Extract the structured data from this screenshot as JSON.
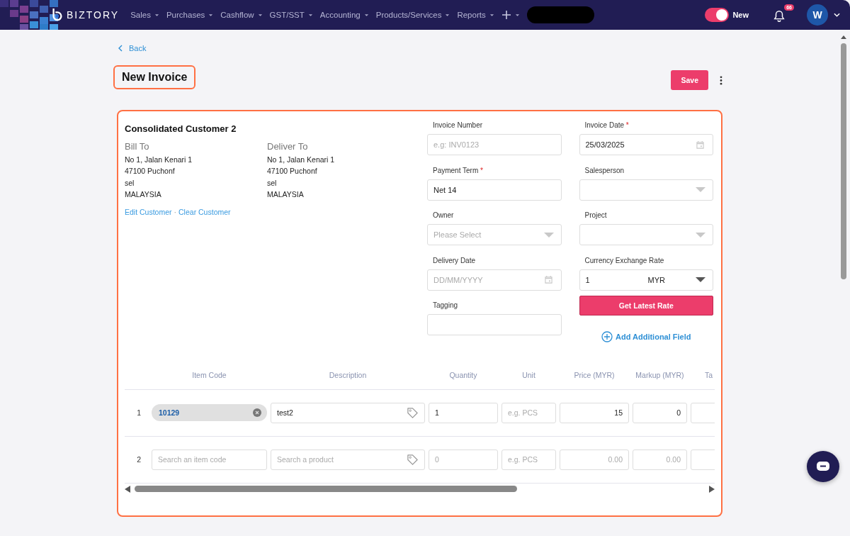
{
  "nav": {
    "brand": "BIZTORY",
    "menu": [
      {
        "label": "Sales"
      },
      {
        "label": "Purchases"
      },
      {
        "label": "Cashflow"
      },
      {
        "label": "GST/SST"
      },
      {
        "label": "Accounting"
      },
      {
        "label": "Products/Services"
      },
      {
        "label": "Reports"
      }
    ],
    "new_toggle": {
      "label": "New",
      "on": true
    },
    "notifications": {
      "badge": "66"
    },
    "avatar": {
      "initial": "W"
    }
  },
  "back": "Back",
  "title": "New Invoice",
  "save": "Save",
  "customer": {
    "name": "Consolidated Customer 2",
    "addresses": [
      {
        "heading": "Bill To",
        "lines": [
          "No 1, Jalan Kenari 1",
          "47100 Puchonf",
          "sel",
          "MALAYSIA"
        ]
      },
      {
        "heading": "Deliver To",
        "lines": [
          "No 1, Jalan Kenari 1",
          "47100 Puchonf",
          "sel",
          "MALAYSIA"
        ]
      }
    ],
    "edit_link": "Edit Customer",
    "separator": "·",
    "clear_link": "Clear Customer"
  },
  "fields_left": [
    {
      "kind": "text",
      "label": "Invoice Number",
      "placeholder": "e.g: INV0123"
    },
    {
      "kind": "text",
      "label": "Payment Term",
      "mark": "*",
      "value": "Net 14"
    },
    {
      "kind": "select",
      "label": "Owner",
      "placeholder": "Please Select"
    },
    {
      "kind": "date",
      "label": "Delivery Date",
      "placeholder": "DD/MM/YYYY"
    },
    {
      "kind": "text",
      "label": "Tagging"
    }
  ],
  "fields_right": [
    {
      "kind": "date",
      "label": "Invoice Date",
      "mark": "*",
      "value": "25/03/2025"
    },
    {
      "kind": "select",
      "label": "Salesperson"
    },
    {
      "kind": "select",
      "label": "Project"
    },
    {
      "kind": "currency",
      "label": "Currency Exchange Rate",
      "value": "1",
      "currency": "MYR"
    }
  ],
  "rate_button": "Get Latest Rate",
  "add_field": "Add Additional Field",
  "table": {
    "columns": [
      "Item Code",
      "Description",
      "Quantity",
      "Unit",
      "Price (MYR)",
      "Markup (MYR)",
      "Ta"
    ],
    "rows": [
      {
        "number": "1",
        "item_code": {
          "value": "10129"
        },
        "description": {
          "value": "test2"
        },
        "quantity": {
          "value": "1"
        },
        "unit": {
          "placeholder": "e.g. PCS"
        },
        "price": {
          "value": "15"
        },
        "markup": {
          "value": "0"
        }
      },
      {
        "number": "2",
        "item_code": {
          "placeholder": "Search an item code"
        },
        "description": {
          "placeholder": "Search a product"
        },
        "quantity": {
          "placeholder": "0"
        },
        "unit": {
          "placeholder": "e.g. PCS"
        },
        "price": {
          "placeholder": "0.00"
        },
        "markup": {
          "placeholder": "0.00"
        }
      }
    ]
  }
}
